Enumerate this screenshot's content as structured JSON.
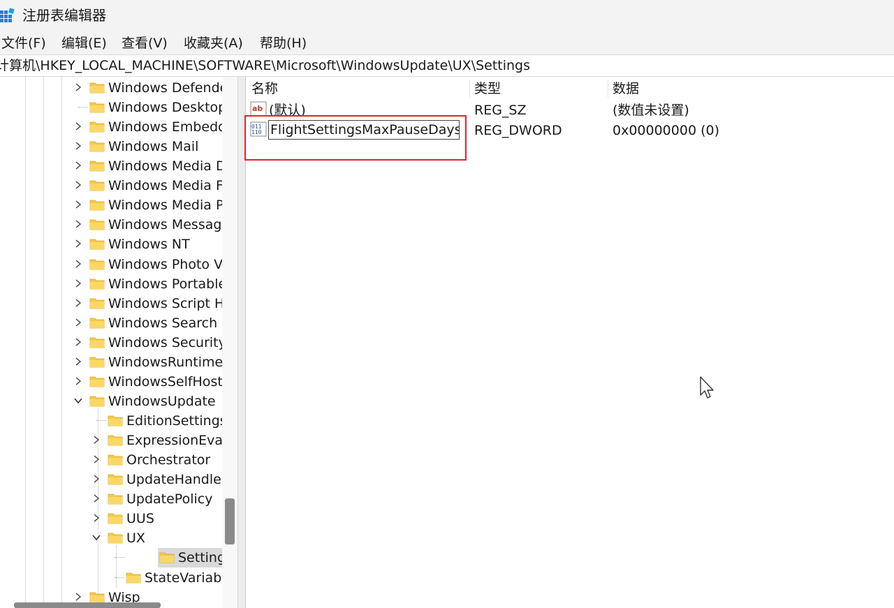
{
  "window": {
    "title": "注册表编辑器"
  },
  "menu": [
    "文件(F)",
    "编辑(E)",
    "查看(V)",
    "收藏夹(A)",
    "帮助(H)"
  ],
  "address": {
    "path": "计算机\\HKEY_LOCAL_MACHINE\\SOFTWARE\\Microsoft\\WindowsUpdate\\UX\\Settings"
  },
  "tree": {
    "items": [
      {
        "label": "Windows Defender",
        "expandable": true
      },
      {
        "label": "Windows Desktop",
        "expandable": false
      },
      {
        "label": "Windows Embedded",
        "expandable": true
      },
      {
        "label": "Windows Mail",
        "expandable": true
      },
      {
        "label": "Windows Media D",
        "expandable": true
      },
      {
        "label": "Windows Media F",
        "expandable": true
      },
      {
        "label": "Windows Media P",
        "expandable": true
      },
      {
        "label": "Windows Messaging",
        "expandable": true
      },
      {
        "label": "Windows NT",
        "expandable": true
      },
      {
        "label": "Windows Photo V",
        "expandable": true
      },
      {
        "label": "Windows Portable",
        "expandable": true
      },
      {
        "label": "Windows Script H",
        "expandable": true
      },
      {
        "label": "Windows Search",
        "expandable": true
      },
      {
        "label": "Windows Security",
        "expandable": true
      },
      {
        "label": "WindowsRuntime",
        "expandable": true
      },
      {
        "label": "WindowsSelfHost",
        "expandable": true
      },
      {
        "label": "WindowsUpdate",
        "expanded": true
      },
      {
        "label": "EditionSettings",
        "expandable": false
      },
      {
        "label": "ExpressionEva",
        "expandable": true
      },
      {
        "label": "Orchestrator",
        "expandable": true
      },
      {
        "label": "UpdateHandlers",
        "expandable": true
      },
      {
        "label": "UpdatePolicy",
        "expandable": true
      },
      {
        "label": "UUS",
        "expandable": true
      },
      {
        "label": "UX",
        "expanded": true
      },
      {
        "label": "Settings",
        "selected": true
      },
      {
        "label": "StateVariables",
        "expandable": false
      },
      {
        "label": "Wisp",
        "expandable": true
      }
    ]
  },
  "list": {
    "columns": [
      "名称",
      "类型",
      "数据"
    ],
    "rows": [
      {
        "name": "(默认)",
        "type": "REG_SZ",
        "data": "(数值未设置)",
        "icon": "string-value-icon"
      },
      {
        "name": "FlightSettingsMaxPauseDays",
        "type": "REG_DWORD",
        "data": "0x00000000 (0)",
        "icon": "dword-value-icon",
        "renaming": true
      }
    ]
  },
  "colors": {
    "highlight": "#e0252f",
    "folder": "#f7c948",
    "selection": "#d9d9d9"
  }
}
